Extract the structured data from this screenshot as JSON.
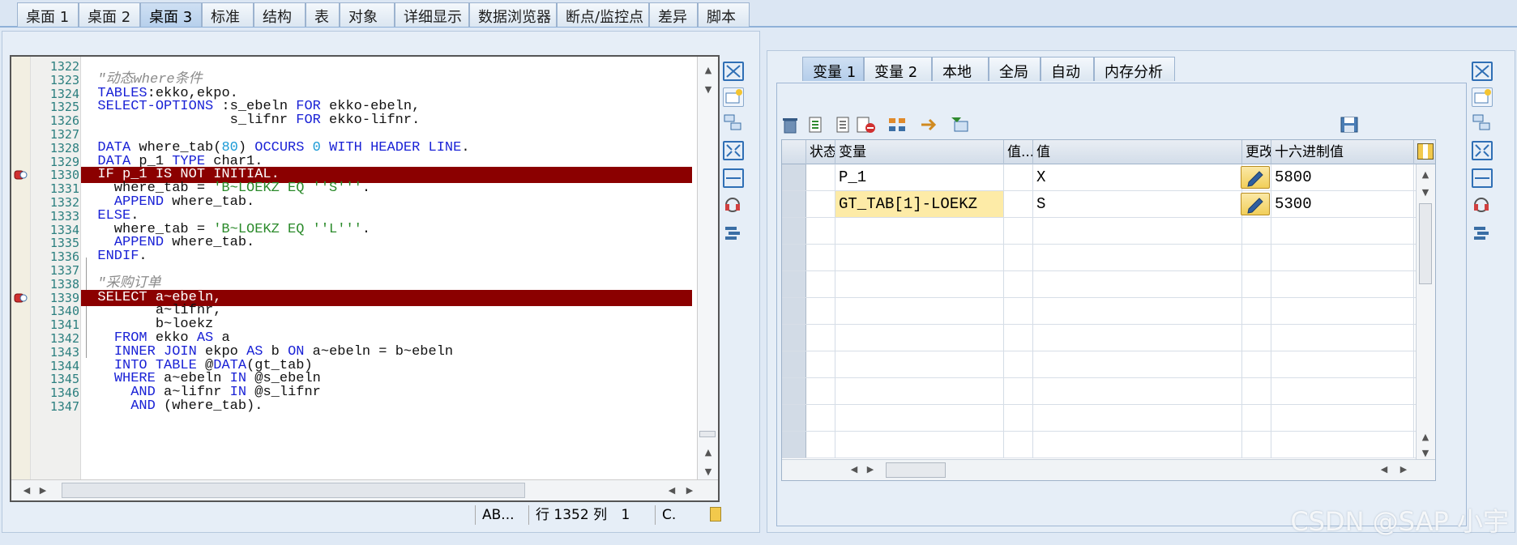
{
  "top_tabs": [
    {
      "label": "桌面 1"
    },
    {
      "label": "桌面 2"
    },
    {
      "label": "桌面 3",
      "active": true
    },
    {
      "label": "标准"
    },
    {
      "label": "结构"
    },
    {
      "label": "表"
    },
    {
      "label": "对象"
    },
    {
      "label": "详细显示"
    },
    {
      "label": "数据浏览器"
    },
    {
      "label": "断点/监控点"
    },
    {
      "label": "差异"
    },
    {
      "label": "脚本"
    }
  ],
  "editor": {
    "lines": [
      {
        "num": "1322",
        "text": ""
      },
      {
        "num": "1323",
        "text": "  \"动态where条件"
      },
      {
        "num": "1324",
        "text": "  TABLES:ekko,ekpo."
      },
      {
        "num": "1325",
        "text": "  SELECT-OPTIONS :s_ebeln FOR ekko-ebeln,"
      },
      {
        "num": "1326",
        "text": "                  s_lifnr FOR ekko-lifnr."
      },
      {
        "num": "1327",
        "text": ""
      },
      {
        "num": "1328",
        "text": "  DATA where_tab(80) OCCURS 0 WITH HEADER LINE."
      },
      {
        "num": "1329",
        "text": "  DATA p_1 TYPE char1."
      },
      {
        "num": "1330",
        "text": "  IF p_1 IS NOT INITIAL.",
        "highlight": true,
        "breakpoint": true
      },
      {
        "num": "1331",
        "text": "    where_tab = 'B~LOEKZ EQ ''S'''."
      },
      {
        "num": "1332",
        "text": "    APPEND where_tab."
      },
      {
        "num": "1333",
        "text": "  ELSE."
      },
      {
        "num": "1334",
        "text": "    where_tab = 'B~LOEKZ EQ ''L'''."
      },
      {
        "num": "1335",
        "text": "    APPEND where_tab."
      },
      {
        "num": "1336",
        "text": "  ENDIF."
      },
      {
        "num": "1337",
        "text": ""
      },
      {
        "num": "1338",
        "text": "  \"采购订单"
      },
      {
        "num": "1339",
        "text": "  SELECT a~ebeln,",
        "highlight": true,
        "breakpoint": true
      },
      {
        "num": "1340",
        "text": "         a~lifnr,"
      },
      {
        "num": "1341",
        "text": "         b~loekz"
      },
      {
        "num": "1342",
        "text": "    FROM ekko AS a"
      },
      {
        "num": "1343",
        "text": "    INNER JOIN ekpo AS b ON a~ebeln = b~ebeln"
      },
      {
        "num": "1344",
        "text": "    INTO TABLE @DATA(gt_tab)"
      },
      {
        "num": "1345",
        "text": "    WHERE a~ebeln IN @s_ebeln"
      },
      {
        "num": "1346",
        "text": "      AND a~lifnr IN @s_lifnr"
      },
      {
        "num": "1347",
        "text": "      AND (where_tab)."
      }
    ]
  },
  "status_bar": {
    "mode": "AB...",
    "row_label": "行",
    "row": "1352",
    "col_label": "列",
    "col": "1",
    "extra": "C."
  },
  "var_tabs": [
    {
      "label": "变量 1",
      "active": true
    },
    {
      "label": "变量 2"
    },
    {
      "label": "本地"
    },
    {
      "label": "全局"
    },
    {
      "label": "自动"
    },
    {
      "label": "内存分析"
    }
  ],
  "grid": {
    "headers": [
      "状态",
      "变量",
      "值...",
      "值",
      "更改",
      "十六进制值"
    ],
    "rows": [
      {
        "variable": "P_1",
        "value": "X",
        "hex": "5800"
      },
      {
        "variable": "GT_TAB[1]-LOEKZ",
        "value": "S",
        "hex": "5300"
      }
    ]
  },
  "watermark": "CSDN @SAP 小宇",
  "colors": {
    "highlight": "#8b0000",
    "keyword": "#1a22d6",
    "string": "#2a8a2a",
    "comment": "#888888",
    "focus_cell": "#fdeba7"
  }
}
